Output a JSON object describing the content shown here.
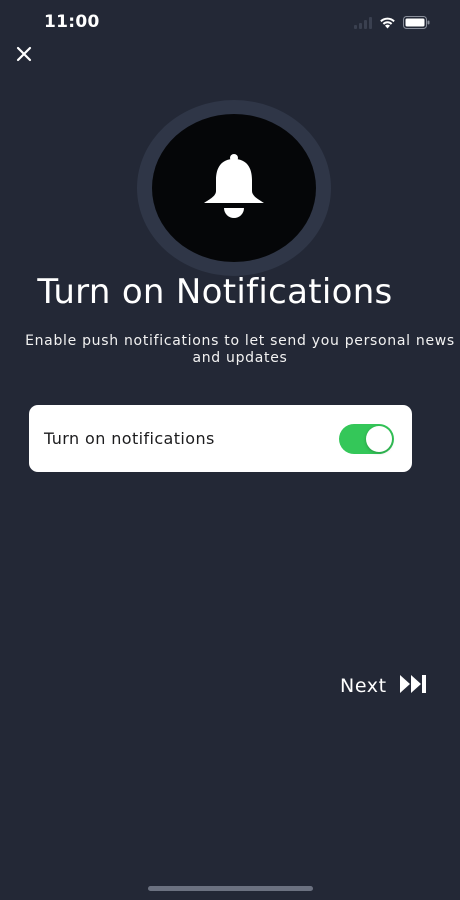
{
  "status_bar": {
    "time": "11:00"
  },
  "icons": {
    "close": "close-icon",
    "bell": "bell-icon",
    "next": "fast-forward-icon",
    "signal": "cellular-signal-icon",
    "wifi": "wifi-icon",
    "battery": "battery-icon"
  },
  "onboarding": {
    "title": "Turn on Notifications",
    "subtitle": "Enable push notifications to let send you personal news and updates",
    "toggle": {
      "label": "Turn on notifications",
      "state": true
    },
    "next_label": "Next"
  },
  "colors": {
    "background": "#232836",
    "bell_ring": "#2f3647",
    "bell_circle": "#050608",
    "toggle_on": "#34c759",
    "card": "#ffffff"
  }
}
